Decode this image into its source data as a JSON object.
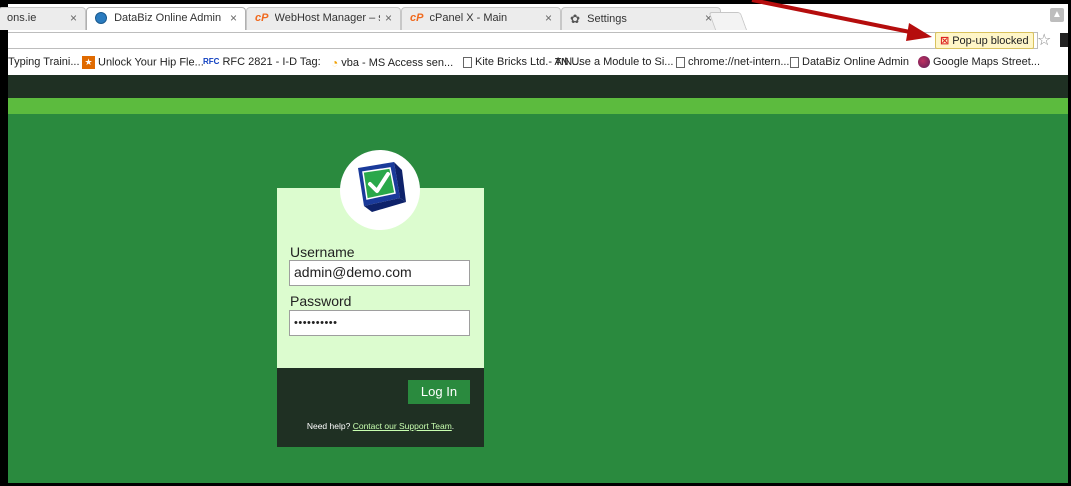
{
  "tabs": [
    {
      "title": "ons.ie",
      "favicon": "none",
      "active": false
    },
    {
      "title": "DataBiz Online Admin",
      "favicon": "globe-icon",
      "active": true
    },
    {
      "title": "WebHost Manager – serve",
      "favicon": "cpanel-icon",
      "active": false
    },
    {
      "title": "cPanel X - Main",
      "favicon": "cpanel-icon",
      "active": false
    },
    {
      "title": "Settings",
      "favicon": "gear-icon",
      "active": false
    }
  ],
  "tab_close_glyph": "×",
  "omnibox": {
    "popup_blocked_label": "Pop-up blocked",
    "bookmark_star_icon": "star-icon"
  },
  "bookmarks": [
    {
      "label": "Typing Traini...",
      "icon": "none"
    },
    {
      "label": "Unlock Your Hip Fle...",
      "icon": "star-icon"
    },
    {
      "label": "RFC 2821 - I-D Tag:",
      "icon": "rfc-icon"
    },
    {
      "label": "vba - MS Access sen...",
      "icon": "feed-icon"
    },
    {
      "label": "Kite Bricks Ltd.- A N...",
      "icon": "document-icon"
    },
    {
      "label": "Use a Module to Si...",
      "icon": "tn-icon"
    },
    {
      "label": "chrome://net-intern...",
      "icon": "document-icon"
    },
    {
      "label": "DataBiz Online Admin",
      "icon": "document-icon"
    },
    {
      "label": "Google Maps Street...",
      "icon": "maps-icon"
    }
  ],
  "bookmark_icon_glyphs": {
    "rfc": "RFC",
    "tn": "TN"
  },
  "login": {
    "username_label": "Username",
    "username_value": "admin@demo.com",
    "password_label": "Password",
    "password_value": "••••••••••",
    "login_button": "Log In",
    "help_prefix": "Need help?",
    "help_link": "Contact our Support Team",
    "help_suffix": "."
  },
  "colors": {
    "header_dark": "#1f3023",
    "accent_green": "#5cbb3e",
    "page_green": "#2a8a3e",
    "card_light": "#dcfccf",
    "annotation_red": "#b50d0d"
  }
}
